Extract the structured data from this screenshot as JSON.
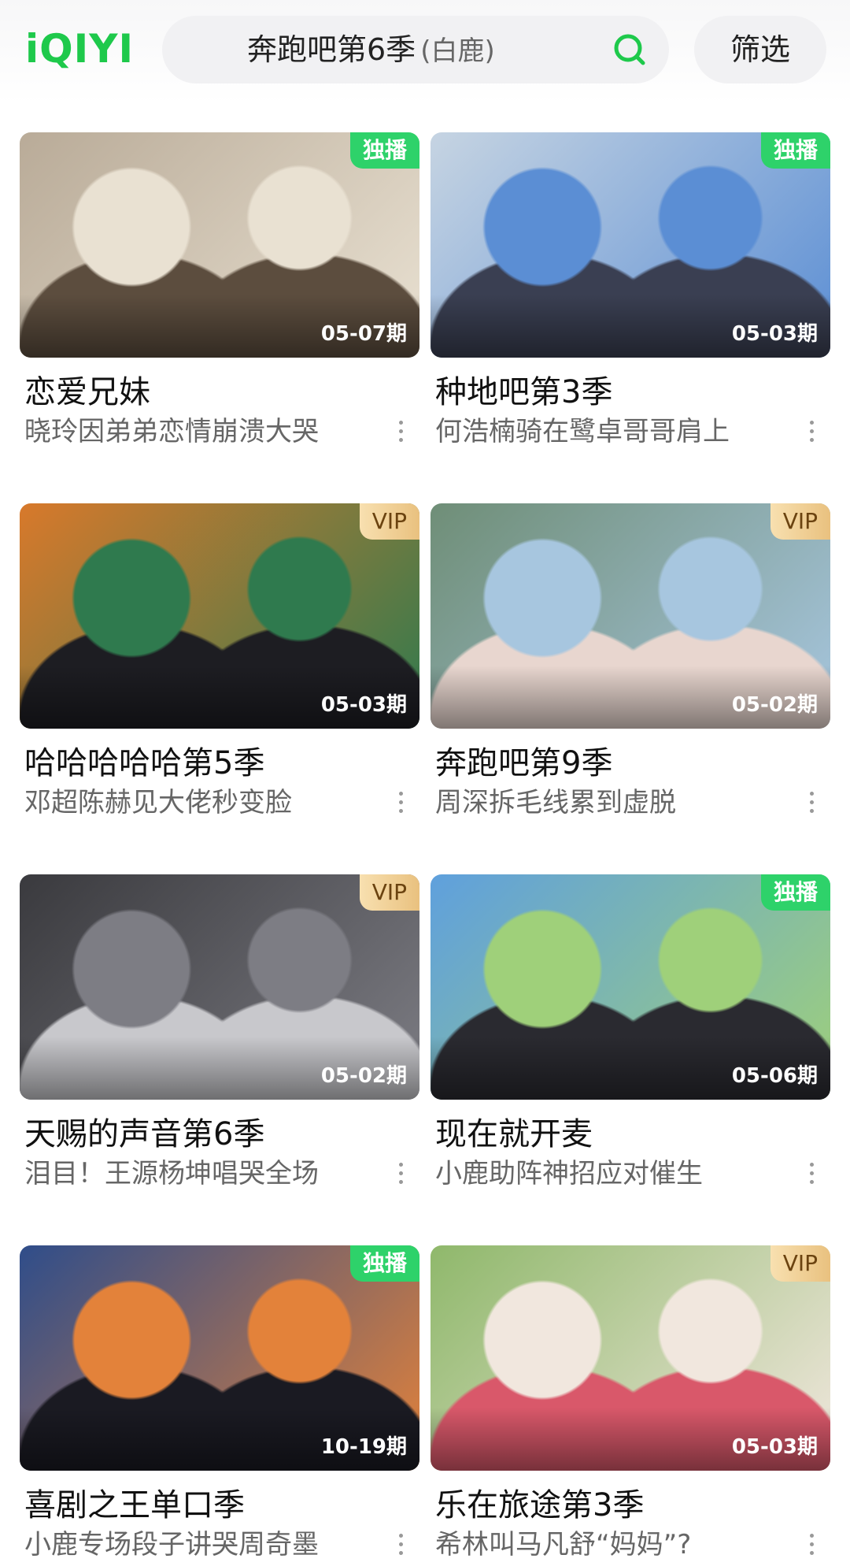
{
  "header": {
    "logo": "iQIYI",
    "search_query": "奔跑吧第6季",
    "search_hint": "(白鹿)",
    "filter_label": "筛选",
    "accent_color": "#1ec94b"
  },
  "cards": [
    {
      "title": "恋爱兄妹",
      "subtitle": "晓玲因弟弟恋情崩溃大哭",
      "badge": "独播",
      "badge_type": "exclusive",
      "episode": "05-07期",
      "palette": [
        "#b9ab98",
        "#e9e1d2",
        "#5c4d3e"
      ]
    },
    {
      "title": "种地吧第3季",
      "subtitle": "何浩楠骑在鹭卓哥哥肩上",
      "badge": "独播",
      "badge_type": "exclusive",
      "episode": "05-03期",
      "palette": [
        "#c6d4e2",
        "#5b8ed4",
        "#3a3f52"
      ]
    },
    {
      "title": "哈哈哈哈哈第5季",
      "subtitle": "邓超陈赫见大佬秒变脸",
      "badge": "VIP",
      "badge_type": "vip",
      "episode": "05-03期",
      "palette": [
        "#d8792b",
        "#2f7a4e",
        "#1d1d22"
      ]
    },
    {
      "title": "奔跑吧第9季",
      "subtitle": "周深拆毛线累到虚脱",
      "badge": "VIP",
      "badge_type": "vip",
      "episode": "05-02期",
      "palette": [
        "#6f8e77",
        "#a7c6df",
        "#e8d6cf"
      ]
    },
    {
      "title": "天赐的声音第6季",
      "subtitle": "泪目！王源杨坤唱哭全场",
      "badge": "VIP",
      "badge_type": "vip",
      "episode": "05-02期",
      "palette": [
        "#3a3a3e",
        "#7d7d84",
        "#c8c8cc"
      ]
    },
    {
      "title": "现在就开麦",
      "subtitle": "小鹿助阵神招应对催生",
      "badge": "独播",
      "badge_type": "exclusive",
      "episode": "05-06期",
      "palette": [
        "#5fa0dd",
        "#9fd07a",
        "#2a2a30"
      ]
    },
    {
      "title": "喜剧之王单口季",
      "subtitle": "小鹿专场段子讲哭周奇墨",
      "badge": "独播",
      "badge_type": "exclusive",
      "episode": "10-19期",
      "palette": [
        "#2f4d8a",
        "#e3823a",
        "#1a1a22"
      ]
    },
    {
      "title": "乐在旅途第3季",
      "subtitle": "希林叫马凡舒“妈妈”?",
      "badge": "VIP",
      "badge_type": "vip",
      "episode": "05-03期",
      "palette": [
        "#8fb86b",
        "#f1e7de",
        "#d9586a"
      ]
    }
  ]
}
